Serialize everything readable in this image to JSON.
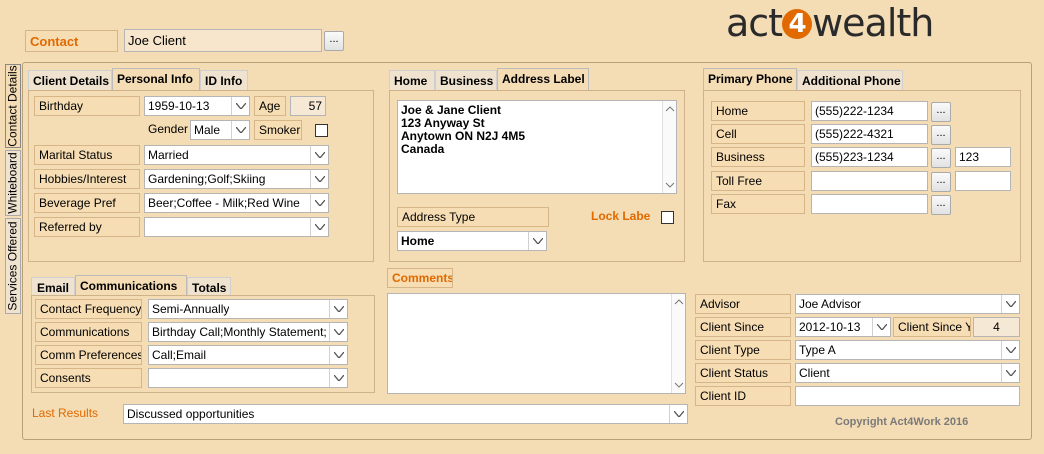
{
  "header": {
    "contact_label": "Contact",
    "contact_value": "Joe Client",
    "logo_left": "act",
    "logo_num": "4",
    "logo_right": "wealth"
  },
  "side_tabs": [
    "Contact Details",
    "Whiteboard",
    "Services Offered"
  ],
  "client_tabs": [
    "Client Details",
    "Personal Info",
    "ID Info"
  ],
  "personal": {
    "birthday_label": "Birthday",
    "birthday": "1959-10-13",
    "age_label": "Age",
    "age": "57",
    "gender_label": "Gender",
    "gender": "Male",
    "smoker_label": "Smoker",
    "marital_label": "Marital Status",
    "marital": "Married",
    "hobbies_label": "Hobbies/Interest",
    "hobbies": "Gardening;Golf;Skiing",
    "beverage_label": "Beverage Pref",
    "beverage": "Beer;Coffee - Milk;Red Wine",
    "referred_label": "Referred by",
    "referred": ""
  },
  "address_tabs": [
    "Home",
    "Business",
    "Address Label"
  ],
  "address": {
    "lines": [
      "Joe & Jane Client",
      "123 Anyway St",
      "Anytown ON N2J 4M5",
      "Canada"
    ],
    "type_label": "Address Type",
    "type": "Home",
    "lock_label": "Lock Label"
  },
  "phone_tabs": [
    "Primary Phone",
    "Additional Phone"
  ],
  "phones": [
    {
      "label": "Home",
      "value": "(555)222-1234",
      "ext": null
    },
    {
      "label": "Cell",
      "value": "(555)222-4321",
      "ext": null
    },
    {
      "label": "Business",
      "value": "(555)223-1234",
      "ext": "123"
    },
    {
      "label": "Toll Free",
      "value": "",
      "ext": ""
    },
    {
      "label": "Fax",
      "value": "",
      "ext": null
    }
  ],
  "comm_tabs": [
    "Email",
    "Communications",
    "Totals"
  ],
  "comm": {
    "freq_label": "Contact Frequency",
    "freq": "Semi-Annually",
    "comms_label": "Communications",
    "comms": "Birthday Call;Monthly Statement;RRS",
    "pref_label": "Comm Preferences",
    "pref": "Call;Email",
    "consents_label": "Consents",
    "consents": ""
  },
  "comments_label": "Comments",
  "advisor": {
    "advisor_label": "Advisor",
    "advisor": "Joe Advisor",
    "since_label": "Client Since",
    "since": "2012-10-13",
    "years_label": "Client Since Yrs",
    "years": "4",
    "type_label": "Client Type",
    "type": "Type A",
    "status_label": "Client Status",
    "status": "Client",
    "id_label": "Client ID",
    "id": ""
  },
  "last_results_label": "Last Results",
  "last_results": "Discussed opportunities",
  "copyright": "Copyright Act4Work 2016",
  "colors": {
    "accent": "#e06a00",
    "background": "#f4dcb4"
  }
}
